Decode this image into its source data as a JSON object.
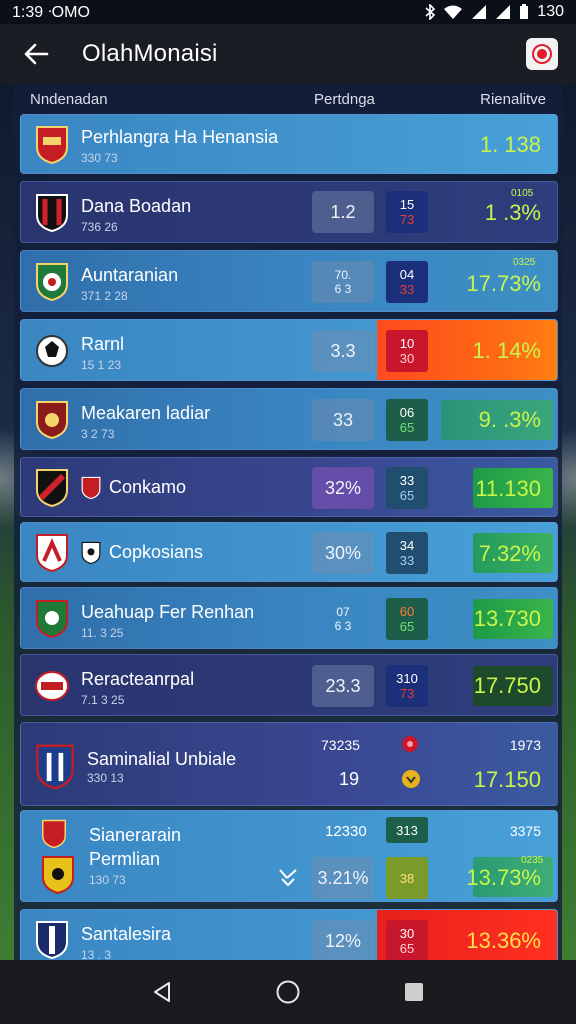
{
  "status_bar": {
    "time": "1:39 ᐧOMO",
    "battery_text": "130"
  },
  "app_bar": {
    "title": "OlahMonaisi"
  },
  "columns": {
    "team": "Nndenadan",
    "value": "Pertdnga",
    "relative": "Rienalitve"
  },
  "rows": [
    {
      "team": "Perhlangra Ha Henansia",
      "sub": "330 73",
      "relative": "1. 138",
      "style": "light"
    },
    {
      "team": "Dana Boadan",
      "sub": "736 26",
      "value": "1.2",
      "mini_top": "15",
      "mini_bottom": "73",
      "rel_small": "0105",
      "relative": "1 .3%",
      "style": "dark"
    },
    {
      "team": "Auntaranian",
      "sub": "371 2 28",
      "value_top": "70.",
      "value_bottom": "6 3",
      "mini_top": "04",
      "mini_bottom": "33",
      "rel_small": "0325",
      "relative": "17.73%",
      "style": "blue"
    },
    {
      "team": "Rarnl",
      "sub": "15 1 23",
      "value": "3.3",
      "mini_top": "10",
      "mini_bottom": "30",
      "relative": "1. 14%",
      "style": "light"
    },
    {
      "team": "Meakaren ladiar",
      "sub": "3 2 73",
      "value": "33",
      "mini_top": "06",
      "mini_bottom": "65",
      "relative": "9. .3%",
      "style": "blue"
    },
    {
      "team": "Conkamo",
      "value": "32%",
      "mini_top": "33",
      "mini_bottom": "65",
      "relative": "11.130",
      "style": "purple"
    },
    {
      "team": "Copkosians",
      "value": "30%",
      "mini_top": "34",
      "mini_bottom": "33",
      "relative": "7.32%",
      "style": "light"
    },
    {
      "team": "Ueahuap Fer Renhan",
      "sub": "11. 3 25",
      "value_top": "07",
      "value_bottom": "6 3",
      "mini_top": "60",
      "mini_bottom": "65",
      "relative": "13.730",
      "style": "blue"
    },
    {
      "team": "Reracteanrpal",
      "sub": "7.1 3 25",
      "value": "23.3",
      "mini_top": "310",
      "mini_bottom": "73",
      "relative": "17.750",
      "style": "dark"
    },
    {
      "team": "Saminalial Unbiale",
      "sub": "330 13",
      "value_top": "73235",
      "value": "19",
      "rel_top": "1973",
      "relative": "17.150",
      "style": "purple"
    },
    {
      "team": "Sianerarain",
      "team2": "Permlian",
      "sub": "130 73",
      "value_top": "12330",
      "value": "3.21%",
      "mini_top": "313",
      "mini_bottom": "38",
      "rel_top": "3375",
      "rel_small": "0235",
      "relative": "13.73%",
      "style": "light"
    },
    {
      "team": "Santalesira",
      "sub": "13 . 3",
      "value": "12%",
      "mini_top": "30",
      "mini_bottom": "65",
      "relative": "13.36%",
      "style": "light"
    }
  ],
  "nav": {
    "back": "back-icon",
    "home": "home-icon",
    "recents": "recents-icon"
  },
  "colors": {
    "accent_green": "#c9f54a",
    "accent_red": "#ff4a1e",
    "app_bar": "#1a1d24"
  }
}
